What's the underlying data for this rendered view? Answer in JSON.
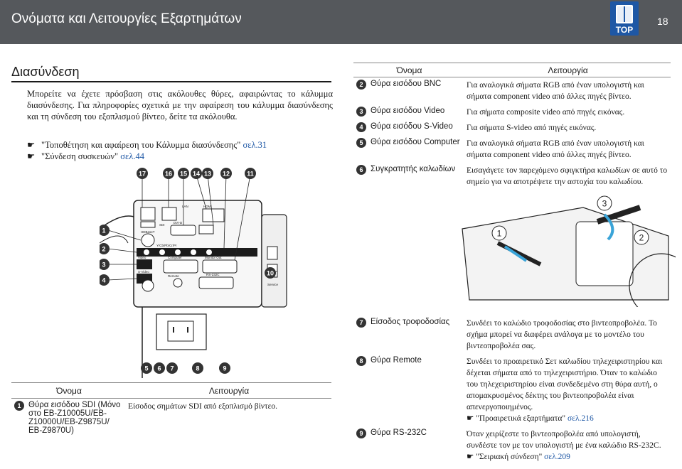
{
  "header": {
    "title": "Ονόματα και Λειτουργίες Εξαρτημάτων",
    "top_badge": "TOP",
    "page_number": "18"
  },
  "section": {
    "title": "Διασύνδεση",
    "intro": "Μπορείτε να έχετε πρόσβαση στις ακόλουθες θύρες, αφαιρώντας το κάλυμμα διασύνδεσης. Για πληροφορίες σχετικά με την αφαίρεση του κάλυμμα διασύνδεσης και τη σύνδεση του εξοπλισμού βίντεο, δείτε τα ακόλουθα.",
    "refs": [
      {
        "text": "\"Τοποθέτηση και αφαίρεση του Κάλυμμα διασύνδεσης\" ",
        "link": "σελ.31"
      },
      {
        "text": "\"Σύνδεση συσκευών\" ",
        "link": "σελ.44"
      }
    ]
  },
  "diagram": {
    "callouts_top": [
      "17",
      "16",
      "15",
      "14",
      "13",
      "12",
      "11"
    ],
    "callouts_left": [
      "1",
      "2",
      "3",
      "4"
    ],
    "callout_right": "10",
    "callouts_bottom": [
      "5",
      "6",
      "7",
      "8",
      "9"
    ],
    "port_labels": [
      "HDBaseT",
      "SDI",
      "DVI-D",
      "HDMI",
      "LAN",
      "Y/Cb/Pb/Cr/Pr",
      "Video",
      "S-Video",
      "Computer",
      "Monitor Out",
      "Remote",
      "RS-232C",
      "Service"
    ]
  },
  "tables": {
    "header_name": "Όνομα",
    "header_function": "Λειτουργία",
    "top_rows": [
      {
        "num": "2",
        "name": "Θύρα εισόδου BNC",
        "func": "Για αναλογικά σήματα RGB από έναν υπολογιστή και σήματα component video από άλλες πηγές βίντεο."
      },
      {
        "num": "3",
        "name": "Θύρα εισόδου Video",
        "func": "Για σήματα composite video από πηγές εικόνας."
      },
      {
        "num": "4",
        "name": "Θύρα εισόδου S-Video",
        "func": "Για σήματα S-video από πηγές εικόνας."
      },
      {
        "num": "5",
        "name": "Θύρα εισόδου Computer",
        "func": "Για αναλογικά σήματα RGB από έναν υπολογιστή και σήματα component video από άλλες πηγές βίντεο."
      },
      {
        "num": "6",
        "name": "Συγκρατητής καλωδίων",
        "func": "Εισαγάγετε τον παρεχόμενο σφιγκτήρα καλωδίων σε αυτό το σημείο για να αποτρέψετε την αστοχία του καλωδίου."
      }
    ],
    "cable_callouts": [
      "1",
      "2",
      "3"
    ],
    "bottom_right_rows": [
      {
        "num": "7",
        "name": "Είσοδος τροφοδοσίας",
        "func": "Συνδέει το καλώδιο τροφοδοσίας στο βιντεοπροβολέα. Το σχήμα μπορεί να διαφέρει ανάλογα με το μοντέλο του βιντεοπροβολέα σας."
      },
      {
        "num": "8",
        "name": "Θύρα Remote",
        "func": "Συνδέει το προαιρετικό Σετ καλωδίου τηλεχειριστηρίου και δέχεται σήματα από το τηλεχειριστήριο. Όταν το καλώδιο του τηλεχειριστηρίου είναι συνδεδεμένο στη θύρα αυτή, ο απομακρυσμένος δέκτης του βιντεοπροβολέα είναι απενεργοποιημένος.",
        "ref_text": "\"Προαιρετικά εξαρτήματα\" ",
        "ref_link": "σελ.216"
      },
      {
        "num": "9",
        "name": "Θύρα RS-232C",
        "func": "Όταν χειρίζεστε το βιντεοπροβολέα από υπολογιστή, συνδέστε τον με τον υπολογιστή με ένα καλώδιο RS-232C.",
        "ref_text": "\"Σειριακή σύνδεση\" ",
        "ref_link": "σελ.209"
      }
    ],
    "bottom_left_rows": [
      {
        "num": "1",
        "name": "Θύρα εισόδου SDI (Μόνο στο EB-Z10005U/EB-Z10000U/EB-Z9875U/ EB-Z9870U)",
        "func": "Είσοδος σημάτων SDI από εξοπλισμό βίντεο."
      }
    ]
  },
  "colors": {
    "header_bg": "#55585c",
    "link": "#1e57a5",
    "badge": "#1e57a5"
  }
}
